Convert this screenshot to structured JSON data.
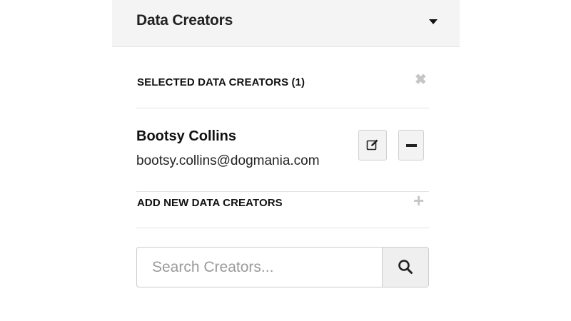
{
  "panel": {
    "title": "Data Creators",
    "caret_icon": "caret-down-icon"
  },
  "selected": {
    "heading": "SELECTED DATA CREATORS (1)",
    "clear_icon": "close-icon",
    "creators": [
      {
        "name": "Bootsy Collins",
        "email": "bootsy.collins@dogmania.com",
        "edit_icon": "edit-icon",
        "remove_icon": "minus-icon"
      }
    ]
  },
  "add_new": {
    "heading": "ADD NEW DATA CREATORS",
    "add_icon": "plus-icon"
  },
  "search": {
    "placeholder": "Search Creators...",
    "value": "",
    "button_icon": "search-icon"
  },
  "colors": {
    "header_bg": "#f4f4f4",
    "muted_icon": "#c6c6c6",
    "button_bg": "#f3f3f3",
    "border": "#cccccc"
  }
}
